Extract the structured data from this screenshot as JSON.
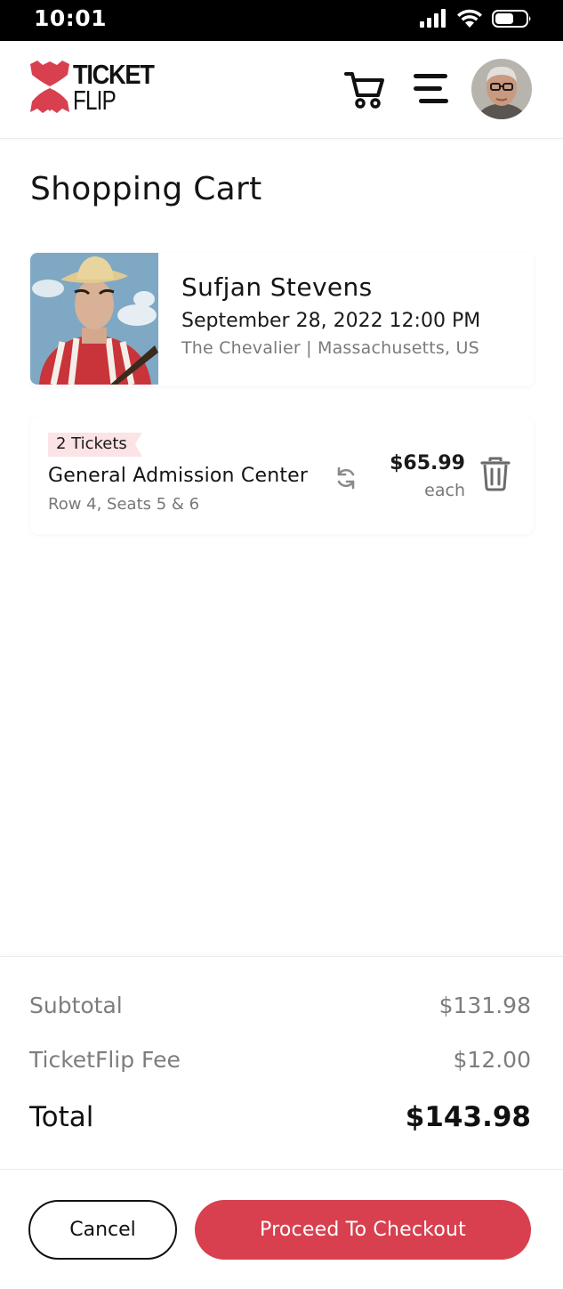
{
  "status_bar": {
    "time": "10:01",
    "icons": [
      "cellular-signal-icon",
      "wifi-icon",
      "battery-icon"
    ]
  },
  "header": {
    "logo": {
      "line1": "TICKET",
      "line2": "FLIP",
      "brand_color": "#d8404f"
    },
    "icons": [
      "cart-icon",
      "menu-icon",
      "avatar"
    ]
  },
  "page": {
    "title": "Shopping Cart"
  },
  "event": {
    "artist": "Sufjan Stevens",
    "date": "September 28, 2022 12:00 PM",
    "venue": "The Chevalier | Massachusetts, US"
  },
  "ticket": {
    "badge": "2 Tickets",
    "section": "General Admission Center",
    "seats": "Row 4, Seats 5 & 6",
    "price": "$65.99",
    "price_unit": "each",
    "icons": [
      "swap-icon",
      "trash-icon"
    ]
  },
  "summary": {
    "subtotal_label": "Subtotal",
    "subtotal_value": "$131.98",
    "fee_label": "TicketFlip Fee",
    "fee_value": "$12.00",
    "total_label": "Total",
    "total_value": "$143.98"
  },
  "actions": {
    "cancel_label": "Cancel",
    "checkout_label": "Proceed To Checkout"
  },
  "colors": {
    "accent": "#d8404f",
    "badge_bg": "#fbe3e6",
    "muted_text": "#7d7d7d"
  }
}
